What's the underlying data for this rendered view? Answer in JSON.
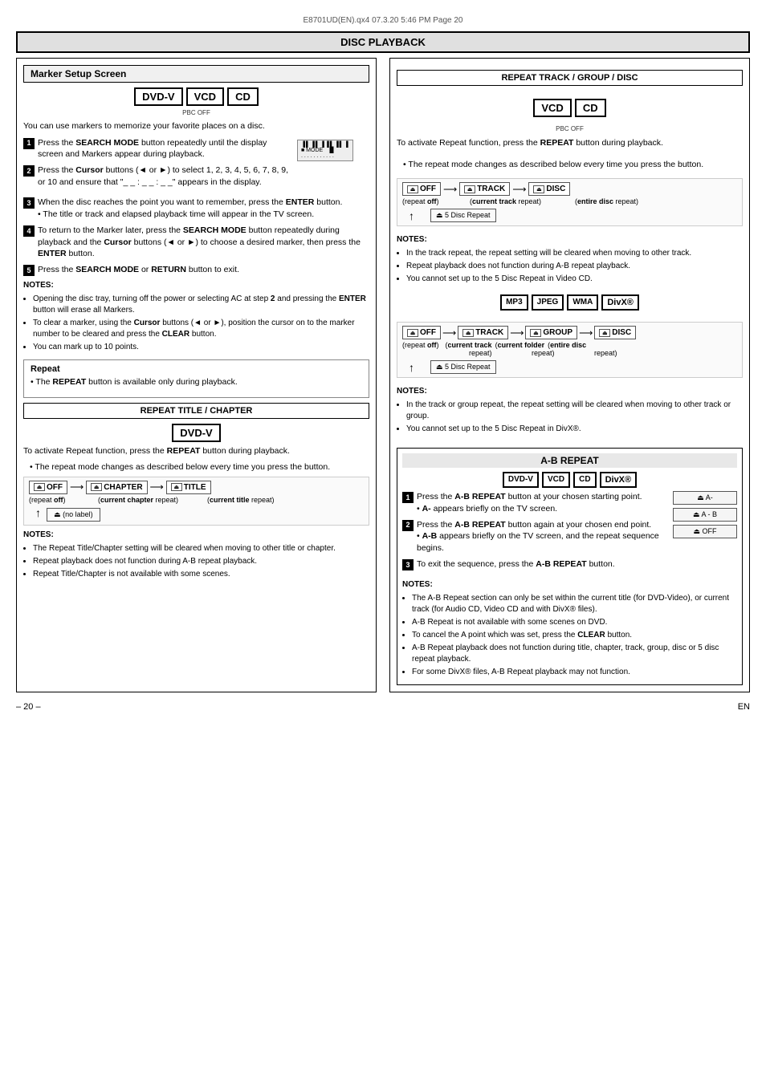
{
  "page_header": "E8701UD(EN).qx4   07.3.20   5:46 PM   Page 20",
  "main_title": "DISC PLAYBACK",
  "left_col": {
    "section_title": "Marker Setup Screen",
    "badges": [
      "DVD-V",
      "VCD",
      "CD"
    ],
    "pbc_label": "PBC OFF",
    "intro_text": "You can use markers to memorize your favorite places on a disc.",
    "steps": [
      {
        "num": "1",
        "text": "Press the SEARCH MODE button repeatedly until the display screen and Markers appear during playback."
      },
      {
        "num": "2",
        "text": "Press the Cursor buttons (◄ or ►) to select 1, 2, 3, 4, 5, 6, 7, 8, 9, or 10 and ensure that \"_ _ : _ _ : _ _\" appears in the display."
      },
      {
        "num": "3",
        "text": "When the disc reaches the point you want to remember, press the ENTER button. • The title or track and elapsed playback time will appear in the TV screen."
      },
      {
        "num": "4",
        "text": "To return to the Marker later, press the SEARCH MODE button repeatedly during playback and the Cursor buttons (◄ or ►) to choose a desired marker, then press the ENTER button."
      },
      {
        "num": "5",
        "text": "Press the SEARCH MODE or RETURN button to exit."
      }
    ],
    "notes_title": "NOTES:",
    "notes": [
      "Opening the disc tray, turning off the power or selecting AC at step 2 and pressing the ENTER button will erase all Markers.",
      "To clear a marker, using the Cursor buttons (◄ or ►), position the cursor on to the marker number to be cleared and press the CLEAR button.",
      "You can mark up to 10 points."
    ],
    "repeat_section": {
      "title": "Repeat",
      "note": "The REPEAT button is available only during playback."
    },
    "repeat_title_chapter": {
      "section_title": "REPEAT TITLE / CHAPTER",
      "badge": "DVD-V",
      "intro": "To activate Repeat function, press the REPEAT button during playback.",
      "bullet": "The repeat mode changes as described below every time you press the button.",
      "flow": {
        "off_label": "OFF",
        "chapter_label": "CHAPTER",
        "title_label": "TITLE",
        "repeat_off": "(repeat off)",
        "current_chapter": "(current chapter repeat)",
        "current_title": "(current title repeat)"
      },
      "notes_title": "NOTES:",
      "notes": [
        "The Repeat Title/Chapter setting will be cleared when moving to other title or chapter.",
        "Repeat playback does not function during A-B repeat playback.",
        "Repeat Title/Chapter is not available with some scenes."
      ]
    }
  },
  "right_col": {
    "section_title": "REPEAT TRACK / GROUP / DISC",
    "badges": [
      "VCD",
      "CD"
    ],
    "pbc_label": "PBC OFF",
    "intro": "To activate Repeat function, press the REPEAT button during playback.",
    "bullet": "The repeat mode changes as described below every time you press the button.",
    "flow_vcd": {
      "off": "OFF",
      "track": "TRACK",
      "disc": "DISC",
      "repeat_off": "(repeat off)",
      "current_track": "(current track repeat)",
      "entire_disc": "(entire disc repeat)",
      "disc_repeat": "5 Disc Repeat"
    },
    "notes_title": "NOTES:",
    "notes_vcd": [
      "In the track repeat, the repeat setting will be cleared when moving to other track.",
      "Repeat playback does not function during A-B repeat playback.",
      "You cannot set up to the 5 Disc Repeat in Video CD."
    ],
    "badges_mp3": [
      "MP3",
      "JPEG",
      "WMA",
      "DivX®"
    ],
    "flow_mp3": {
      "off": "OFF",
      "track": "TRACK",
      "group": "GROUP",
      "disc": "DISC",
      "repeat_off": "(repeat off)",
      "current_track": "(current track repeat)",
      "current_folder": "(current folder repeat)",
      "entire_disc": "(entire disc repeat)",
      "disc_repeat": "5 Disc Repeat"
    },
    "notes_mp3_title": "NOTES:",
    "notes_mp3": [
      "In the track or group repeat, the repeat setting will be cleared when moving to other track or group.",
      "You cannot set up to the 5 Disc Repeat in DivX®."
    ],
    "ab_repeat": {
      "title": "A-B REPEAT",
      "badges": [
        "DVD-V",
        "VCD",
        "CD",
        "DivX®"
      ],
      "steps": [
        {
          "num": "1",
          "text": "Press the A-B REPEAT button at your chosen starting point.",
          "sub": "A- appears briefly on the TV screen.",
          "img_label": "A-"
        },
        {
          "num": "2",
          "text": "Press the A-B REPEAT button again at your chosen end point.",
          "sub": "A-B appears briefly on the TV screen, and the repeat sequence begins.",
          "img_label": "A - B"
        },
        {
          "num": "3",
          "text": "To exit the sequence, press the A-B REPEAT button.",
          "img_label": "OFF"
        }
      ],
      "notes_title": "NOTES:",
      "notes": [
        "The A-B Repeat section can only be set within the current title (for DVD-Video), or current track (for Audio CD, Video CD and with DivX® files).",
        "A-B Repeat is not available with some scenes on DVD.",
        "To cancel the A point which was set, press the CLEAR button.",
        "A-B Repeat playback does not function during title, chapter, track, group, disc or 5 disc repeat playback.",
        "For some DivX® files, A-B Repeat playback may not function."
      ]
    }
  },
  "footer": {
    "page_num": "– 20 –",
    "lang": "EN"
  }
}
